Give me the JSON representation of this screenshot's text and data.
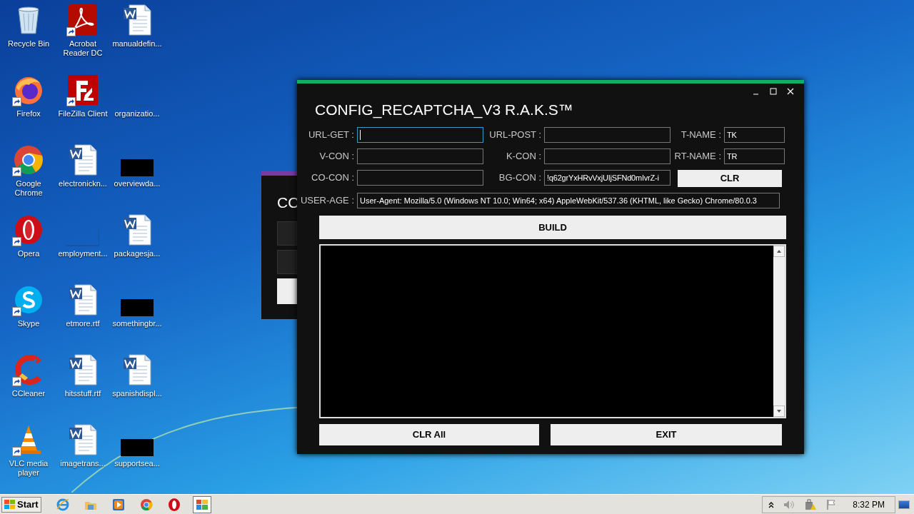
{
  "desktop_icons": [
    {
      "label": "Recycle Bin",
      "kind": "recycle",
      "shortcut": false
    },
    {
      "label": "Acrobat Reader DC",
      "kind": "acrobat",
      "shortcut": true
    },
    {
      "label": "manualdefin...",
      "kind": "word",
      "shortcut": false
    },
    {
      "label": "Firefox",
      "kind": "firefox",
      "shortcut": true
    },
    {
      "label": "FileZilla Client",
      "kind": "filezilla",
      "shortcut": true
    },
    {
      "label": "organizatio...",
      "kind": "blank",
      "shortcut": false
    },
    {
      "label": "Google Chrome",
      "kind": "chrome",
      "shortcut": true
    },
    {
      "label": "electronickn...",
      "kind": "word",
      "shortcut": false
    },
    {
      "label": "overviewda...",
      "kind": "redacted",
      "shortcut": false
    },
    {
      "label": "Opera",
      "kind": "opera",
      "shortcut": true
    },
    {
      "label": "employment...",
      "kind": "blank",
      "shortcut": false
    },
    {
      "label": "packagesja...",
      "kind": "word",
      "shortcut": false
    },
    {
      "label": "Skype",
      "kind": "skype",
      "shortcut": true
    },
    {
      "label": "etmore.rtf",
      "kind": "word",
      "shortcut": false
    },
    {
      "label": "somethingbr...",
      "kind": "redacted",
      "shortcut": false
    },
    {
      "label": "CCleaner",
      "kind": "ccleaner",
      "shortcut": true
    },
    {
      "label": "hitsstuff.rtf",
      "kind": "word",
      "shortcut": false
    },
    {
      "label": "spanishdispl...",
      "kind": "word",
      "shortcut": false
    },
    {
      "label": "VLC media player",
      "kind": "vlc",
      "shortcut": true
    },
    {
      "label": "imagetrans...",
      "kind": "word",
      "shortcut": false
    },
    {
      "label": "supportsea...",
      "kind": "redacted",
      "shortcut": false
    }
  ],
  "background_window": {
    "title": "CO"
  },
  "window": {
    "title": "CONFIG_RECAPTCHA_V3 R.A.K.S™",
    "fields": [
      {
        "label": "URL-GET :",
        "focused": true
      },
      {
        "label": "URL-POST :",
        "focused": false
      },
      {
        "label": "T-NAME :",
        "value": "TK",
        "focused": false
      },
      {
        "label": "V-CON :",
        "focused": false
      },
      {
        "label": "K-CON :",
        "focused": false
      },
      {
        "label": "RT-NAME :",
        "value": "TR",
        "focused": false
      },
      {
        "label": "CO-CON :",
        "focused": false
      },
      {
        "label": "BG-CON :",
        "value": "!q62grYxHRvVxjUIjSFNd0mIvrZ-i",
        "focused": false
      }
    ],
    "clear_button": "CLR",
    "user_agent": {
      "label": "USER-AGE :",
      "value": "User-Agent: Mozilla/5.0 (Windows NT 10.0; Win64; x64) AppleWebKit/537.36 (KHTML, like Gecko) Chrome/80.0.3"
    },
    "build_button": "BUILD",
    "buttons": [
      "CLR All",
      "EXIT"
    ]
  },
  "taskbar": {
    "start": "Start",
    "apps": [
      {
        "kind": "ie",
        "selected": false
      },
      {
        "kind": "explorer",
        "selected": false
      },
      {
        "kind": "media",
        "selected": false
      },
      {
        "kind": "chrome",
        "selected": false
      },
      {
        "kind": "opera",
        "selected": false
      },
      {
        "kind": "window",
        "selected": true
      }
    ],
    "time": "8:32 PM"
  }
}
